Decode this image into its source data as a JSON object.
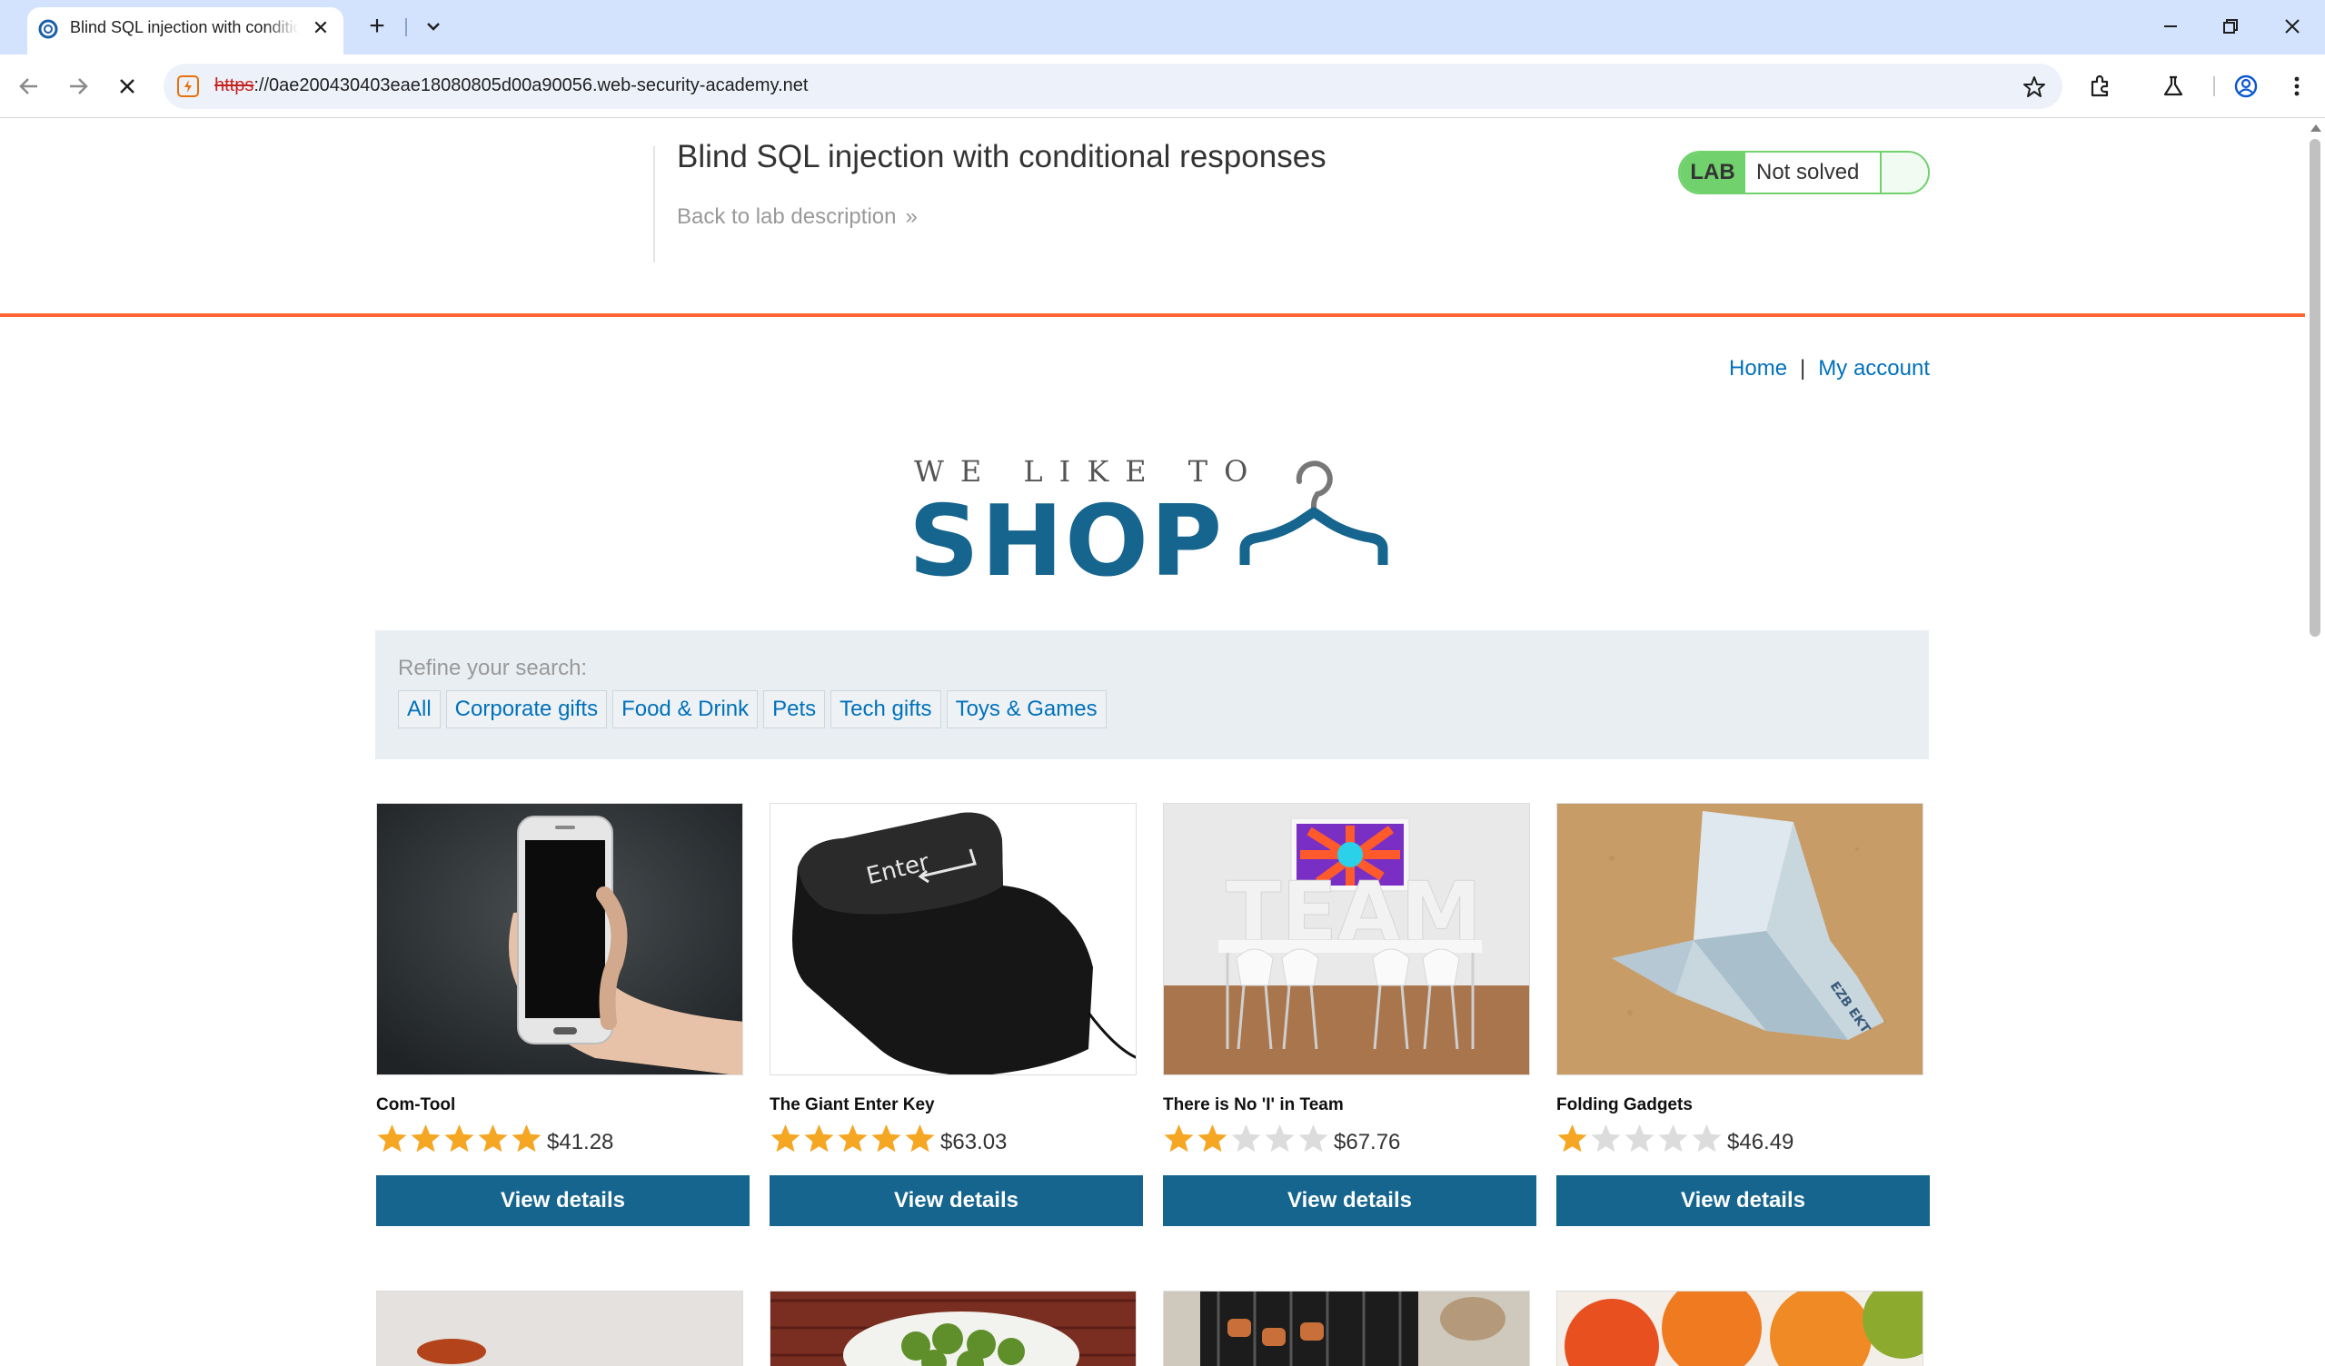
{
  "browser": {
    "tab_title": "Blind SQL injection with conditional responses",
    "tab_close_glyph": "✕",
    "new_tab_glyph": "+",
    "url_scheme": "https",
    "url_rest": "://0ae200430403eae18080805d00a90056.web-security-academy.net",
    "icons": [
      "back-icon",
      "forward-icon",
      "stop-loading-icon",
      "not-secure-icon",
      "bookmark-star-icon",
      "extensions-icon",
      "labs-flask-icon",
      "profile-icon",
      "menu-dots-icon",
      "tab-search-icon",
      "minimize-icon",
      "restore-icon",
      "close-window-icon"
    ]
  },
  "lab": {
    "title": "Blind SQL injection with conditional responses",
    "back_link": "Back to lab description",
    "back_arrow": "»",
    "badge": "LAB",
    "status": "Not solved",
    "accent_color": "#ff6633",
    "status_color": "#70d16d"
  },
  "nav": {
    "home": "Home",
    "separator": "|",
    "account": "My account"
  },
  "logo": {
    "top_text": "WE LIKE TO",
    "main_text": "SHOP",
    "icon": "hanger-icon",
    "color": "#16658f"
  },
  "refine": {
    "label": "Refine your search:",
    "filters": [
      "All",
      "Corporate gifts",
      "Food & Drink",
      "Pets",
      "Tech gifts",
      "Toys & Games"
    ]
  },
  "products": [
    {
      "name": "Com-Tool",
      "rating": 5,
      "price": "$41.28",
      "button": "View details",
      "image": "phone-in-hand"
    },
    {
      "name": "The Giant Enter Key",
      "rating": 5,
      "price": "$63.03",
      "button": "View details",
      "image": "giant-enter-key"
    },
    {
      "name": "There is No 'I' in Team",
      "rating": 2,
      "price": "$67.76",
      "button": "View details",
      "image": "team-letters-room"
    },
    {
      "name": "Folding Gadgets",
      "rating": 1,
      "price": "$46.49",
      "button": "View details",
      "image": "origami-banknote"
    }
  ],
  "colors": {
    "primary": "#16658f",
    "link": "#0071bc",
    "star_filled": "#f5a623",
    "star_empty": "#dcdcdc"
  }
}
